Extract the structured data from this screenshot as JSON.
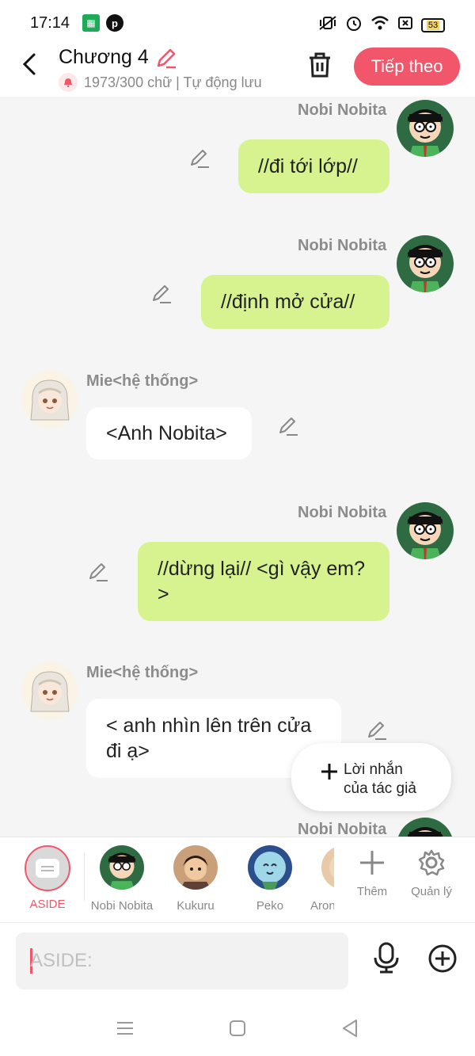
{
  "status": {
    "time": "17:14",
    "battery": "53"
  },
  "header": {
    "title": "Chương 4",
    "subtitle": "1973/300 chữ | Tự động lưu",
    "next_label": "Tiếp theo"
  },
  "messages": [
    {
      "name": "Nobi Nobita",
      "text": "//đi tới lớp//",
      "side": "right"
    },
    {
      "name": "Nobi Nobita",
      "text": "//định mở cửa//",
      "side": "right"
    },
    {
      "name": "Mie<hệ thống>",
      "text": "<Anh Nobita>",
      "side": "left"
    },
    {
      "name": "Nobi Nobita",
      "text": "//dừng lại// <gì vậy em?>",
      "side": "right"
    },
    {
      "name": "Mie<hệ thống>",
      "text": "< anh nhìn lên trên cửa đi ạ>",
      "side": "left"
    },
    {
      "name": "Nobi Nobita",
      "text": "",
      "side": "right"
    }
  ],
  "author_note_button": "Lời nhắn của tác giả",
  "characters": [
    {
      "label": "ASIDE"
    },
    {
      "label": "Nobi Nobita"
    },
    {
      "label": "Kukuru"
    },
    {
      "label": "Peko"
    },
    {
      "label": "Aron"
    }
  ],
  "tools": {
    "add_label": "Thêm",
    "manage_label": "Quản lý"
  },
  "input": {
    "placeholder": "ASIDE:"
  },
  "colors": {
    "accent": "#f2566b",
    "bubble_green": "#d7f390",
    "background": "#f5f5f5"
  }
}
